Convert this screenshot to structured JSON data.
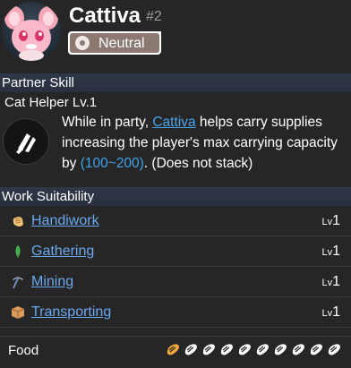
{
  "pal": {
    "name": "Cattiva",
    "number": "#2",
    "element": "Neutral"
  },
  "partner_skill": {
    "section_label": "Partner Skill",
    "title": "Cat Helper Lv.1",
    "desc_prefix": "While in party, ",
    "desc_link": "Cattiva",
    "desc_mid": " helps carry supplies increasing the player's max carrying capacity by ",
    "desc_value": "(100~200)",
    "desc_suffix": ". (Does not stack)"
  },
  "work": {
    "section_label": "Work Suitability",
    "level_prefix": "Lv",
    "items": [
      {
        "label": "Handiwork",
        "level": "1",
        "icon": "hand-icon"
      },
      {
        "label": "Gathering",
        "level": "1",
        "icon": "leaf-icon"
      },
      {
        "label": "Mining",
        "level": "1",
        "icon": "pickaxe-icon"
      },
      {
        "label": "Transporting",
        "level": "1",
        "icon": "box-icon"
      }
    ]
  },
  "food": {
    "label": "Food",
    "filled": 1,
    "total": 10
  },
  "colors": {
    "link": "#6aa8f0",
    "value_blue": "#3fa3ea",
    "element_badge": "#8c7a72",
    "food_filled": "#f2a93b",
    "food_empty": "#ffffff"
  }
}
